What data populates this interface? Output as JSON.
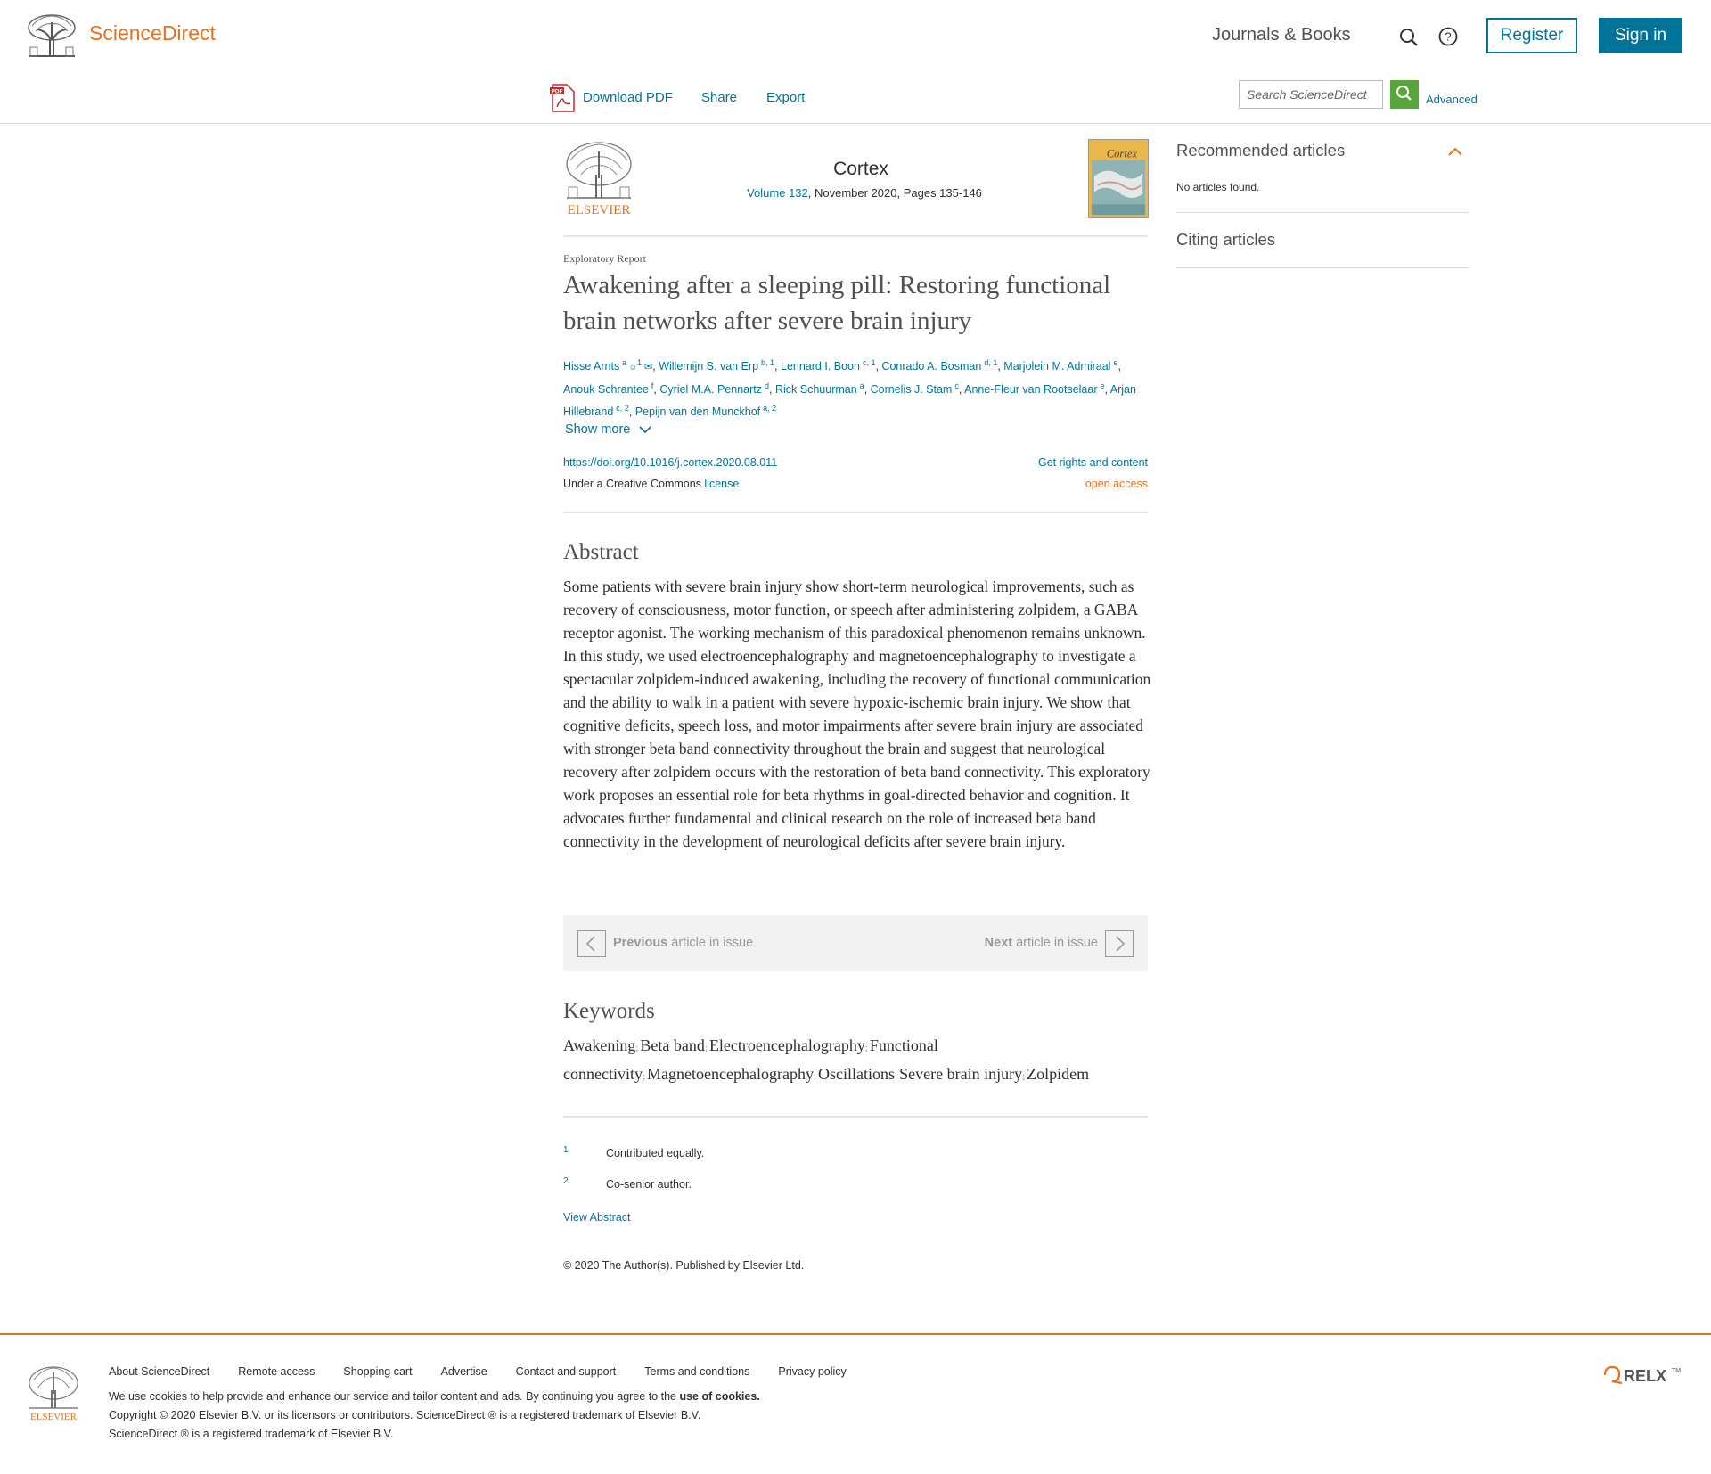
{
  "header": {
    "brand": "ScienceDirect",
    "journals_link": "Journals & Books",
    "register": "Register",
    "sign_in": "Sign in"
  },
  "toolbar": {
    "download_pdf": "Download PDF",
    "share": "Share",
    "export": "Export",
    "search_placeholder": "Search ScienceDirect",
    "advanced": "Advanced"
  },
  "journal": {
    "title": "Cortex",
    "volume": "Volume 132",
    "issue_info": ", November 2020, Pages 135-146",
    "publisher_logo_text": "ELSEVIER"
  },
  "article": {
    "type": "Exploratory Report",
    "title": "Awakening after a sleeping pill: Restoring functional brain networks after severe brain injury",
    "authors": [
      {
        "name": "Hisse Arnts",
        "sup": "a",
        "extra": "1"
      },
      {
        "name": "Willemijn S. van Erp",
        "sup": "b, 1"
      },
      {
        "name": "Lennard I. Boon",
        "sup": "c, 1"
      },
      {
        "name": "Conrado A. Bosman",
        "sup": "d, 1"
      },
      {
        "name": "Marjolein M. Admiraal",
        "sup": "e"
      },
      {
        "name": "Anouk Schrantee",
        "sup": "f"
      },
      {
        "name": "Cyriel M.A. Pennartz",
        "sup": "d"
      },
      {
        "name": "Rick Schuurman",
        "sup": "a"
      },
      {
        "name": "Cornelis J. Stam",
        "sup": "c"
      },
      {
        "name": "Anne-Fleur van Rootselaar",
        "sup": "e"
      },
      {
        "name": "Arjan Hillebrand",
        "sup": "c, 2"
      },
      {
        "name": "Pepijn van den Munckhof",
        "sup": "a, 2"
      }
    ],
    "show_more": "Show more",
    "doi": "https://doi.org/10.1016/j.cortex.2020.08.011",
    "rights": "Get rights and content",
    "cc_prefix": "Under a Creative Commons ",
    "cc_license": "license",
    "open_access": "open access"
  },
  "abstract": {
    "heading": "Abstract",
    "text": "Some patients with severe brain injury show short-term neurological improvements, such as recovery of consciousness, motor function, or speech after administering zolpidem, a GABA receptor agonist. The working mechanism of this paradoxical phenomenon remains unknown. In this study, we used electroencephalography and magnetoencephalography to investigate a spectacular zolpidem-induced awakening, including the recovery of functional communication and the ability to walk in a patient with severe hypoxic-ischemic brain injury. We show that cognitive deficits, speech loss, and motor impairments after severe brain injury are associated with stronger beta band connectivity throughout the brain and suggest that neurological recovery after zolpidem occurs with the restoration of beta band connectivity. This exploratory work proposes an essential role for beta rhythms in goal-directed behavior and cognition. It advocates further fundamental and clinical research on the role of increased beta band connectivity in the development of neurological deficits after severe brain injury."
  },
  "issue_nav": {
    "prev_bold": "Previous",
    "prev_rest": " article in issue",
    "next_bold": "Next",
    "next_rest": " article in issue"
  },
  "keywords": {
    "heading": "Keywords",
    "items": [
      "Awakening",
      "Beta band",
      "Electroencephalography",
      "Functional connectivity",
      "Magnetoencephalography",
      "Oscillations",
      "Severe brain injury",
      "Zolpidem"
    ]
  },
  "footnotes": [
    {
      "num": "1",
      "text": "Contributed equally."
    },
    {
      "num": "2",
      "text": "Co-senior author."
    }
  ],
  "view_abstract": "View Abstract",
  "copyright_article": "© 2020 The Author(s). Published by Elsevier Ltd.",
  "sidebar": {
    "recommended": "Recommended articles",
    "no_articles": "No articles found.",
    "citing": "Citing articles"
  },
  "footer": {
    "links": [
      "About ScienceDirect",
      "Remote access",
      "Shopping cart",
      "Advertise",
      "Contact and support",
      "Terms and conditions",
      "Privacy policy"
    ],
    "cookies_prefix": "We use cookies to help provide and enhance our service and tailor content and ads. By continuing you agree to the ",
    "cookies_link": "use of cookies",
    "cookies_suffix": ".",
    "copyright1": "Copyright © 2020 Elsevier B.V. or its licensors or contributors. ScienceDirect ® is a registered trademark of Elsevier B.V.",
    "copyright2": "ScienceDirect ® is a registered trademark of Elsevier B.V.",
    "logo_text": "ELSEVIER",
    "relx": "RELX"
  },
  "colors": {
    "accent_orange": "#e9711c",
    "link_blue": "#007398",
    "search_green": "#57a63a"
  }
}
